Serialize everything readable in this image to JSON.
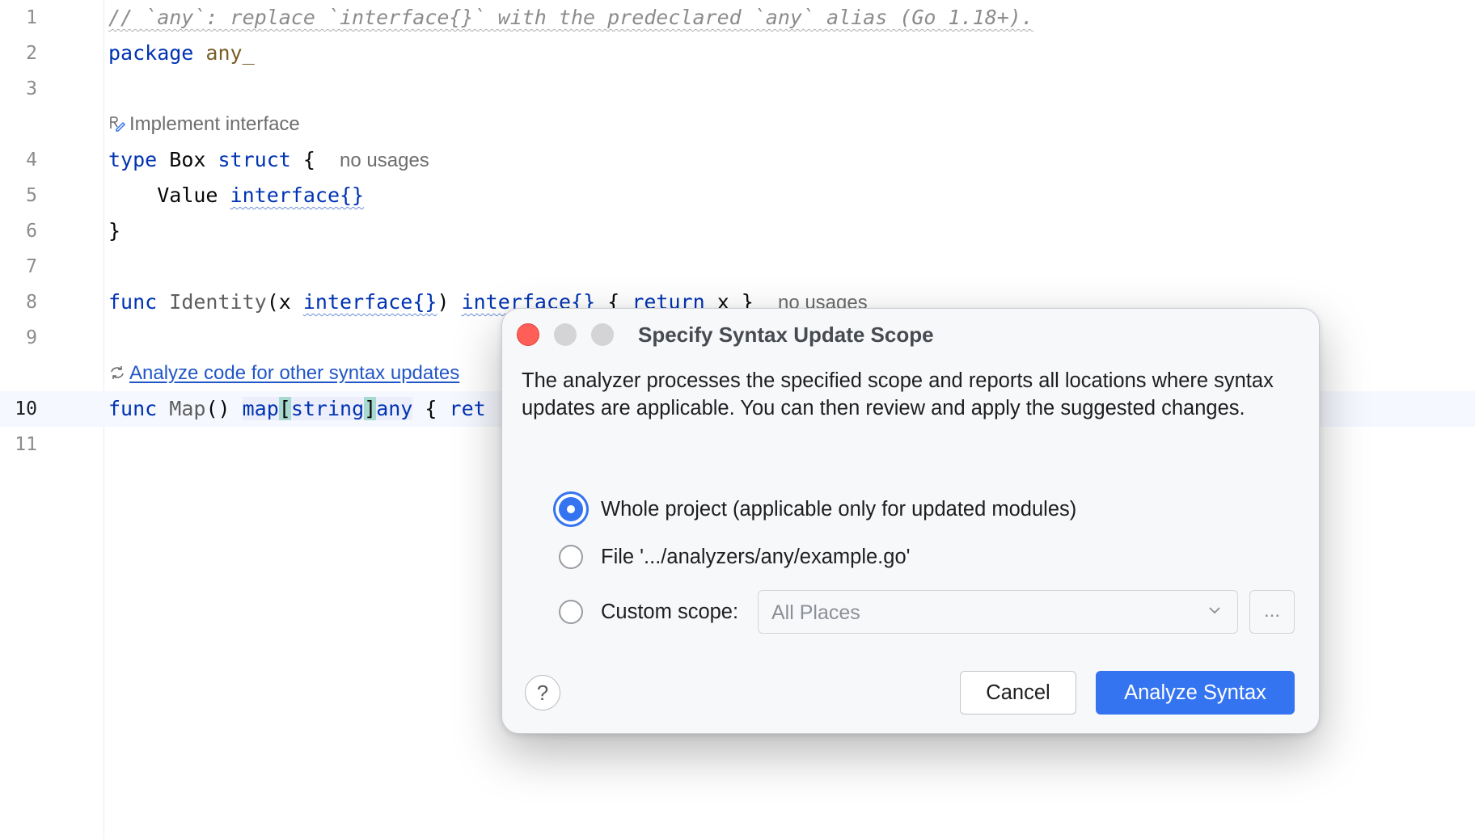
{
  "editor": {
    "lines": [
      {
        "num": "1"
      },
      {
        "num": "2"
      },
      {
        "num": "3"
      },
      {
        "num": "4"
      },
      {
        "num": "5"
      },
      {
        "num": "6"
      },
      {
        "num": "7"
      },
      {
        "num": "8"
      },
      {
        "num": "9"
      },
      {
        "num": "10"
      },
      {
        "num": "11"
      }
    ],
    "line1_comment": "// `any`: replace `interface{}` with the predeclared `any` alias (Go 1.18+).",
    "kw_package": "package",
    "pkg_name": "any_",
    "inlay_implement": "Implement interface",
    "kw_type": "type",
    "type_name": "Box",
    "kw_struct": "struct",
    "brace_open": "{",
    "no_usages": "no usages",
    "field_name": "Value",
    "iface": "interface{}",
    "brace_close": "}",
    "kw_func": "func",
    "fn_identity": "Identity",
    "identity_params_open": "(x ",
    "identity_params_close": ")",
    "kw_return": "return",
    "return_body": "x }",
    "inlay_analyze": "Analyze code for other syntax updates",
    "fn_map": "Map",
    "map_parens": "()",
    "map_kw": "map",
    "lbracket": "[",
    "string_kw": "string",
    "rbracket": "]",
    "any_kw": "any",
    "ret_partial": "ret"
  },
  "dialog": {
    "title": "Specify Syntax Update Scope",
    "description": "The analyzer processes the specified scope and reports all locations where syntax updates are applicable. You can then review and apply the suggested changes.",
    "options": [
      {
        "label": "Whole project (applicable only for updated modules)",
        "checked": true
      },
      {
        "label": "File '.../analyzers/any/example.go'",
        "checked": false
      },
      {
        "label": "Custom scope:",
        "checked": false
      }
    ],
    "custom_scope_value": "All Places",
    "browse_label": "...",
    "help_label": "?",
    "cancel_label": "Cancel",
    "primary_label": "Analyze Syntax"
  },
  "colors": {
    "accent": "#3574f0",
    "keyword": "#0033b3",
    "link": "#2156c7",
    "close_button": "#ff5f57"
  }
}
